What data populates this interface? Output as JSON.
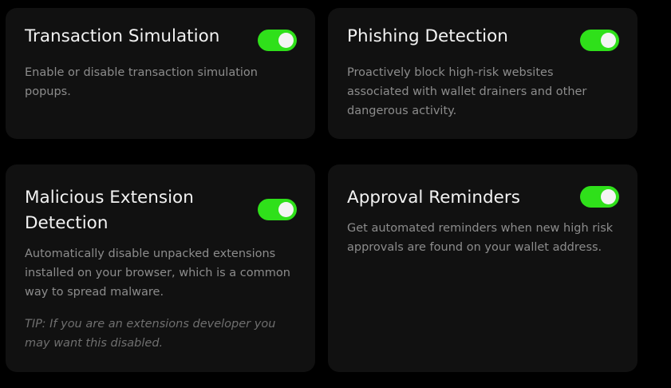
{
  "settings": [
    {
      "title": "Transaction Simulation",
      "description": "Enable or disable transaction simulation popups.",
      "enabled": true
    },
    {
      "title": "Phishing Detection",
      "description": "Proactively block high-risk websites associated with wallet drainers and other dangerous activity.",
      "enabled": true
    },
    {
      "title": "Malicious Extension Detection",
      "description": "Automatically disable unpacked extensions installed on your browser, which is a common way to spread malware.",
      "tip": "TIP: If you are an extensions developer you may want this disabled.",
      "enabled": true
    },
    {
      "title": "Approval Reminders",
      "description": "Get automated reminders when new high risk approvals are found on your wallet address.",
      "enabled": true
    }
  ],
  "colors": {
    "background": "#000000",
    "card": "#111111",
    "toggle_on": "#2fe01a",
    "title": "#f2f2f2",
    "description": "#8c8c8c"
  }
}
